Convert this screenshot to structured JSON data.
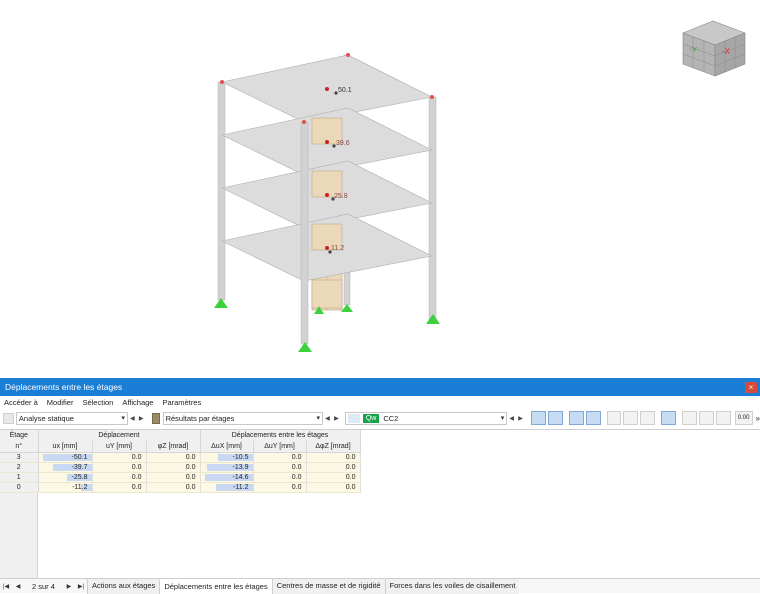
{
  "viewport": {
    "floor_labels": [
      "50.1",
      "39.6",
      "25.8",
      "11.2"
    ],
    "navcube": {
      "y_axis": "-Y",
      "x_axis": "-X"
    }
  },
  "window": {
    "title": "Déplacements entre les étages",
    "close": "×"
  },
  "menu": [
    "Accéder à",
    "Modifier",
    "Sélection",
    "Affichage",
    "Paramètres"
  ],
  "toolbar": {
    "analysis": "Analyse statique",
    "results": "Résultats par étages",
    "load_type": "Qw",
    "load_case": "CC2",
    "zoom_value": "0.00",
    "overflow": "»"
  },
  "table": {
    "col_floor": "Étage",
    "col_floor_sub": "n°",
    "group_disp": "Déplacement",
    "group_drift": "Déplacements entre les étages",
    "cols": [
      "ux [mm]",
      "uY [mm]",
      "φZ [mrad]",
      "ΔuX [mm]",
      "ΔuY [mm]",
      "ΔφZ [mrad]"
    ],
    "rows": [
      {
        "floor": "3",
        "ux": "-50.1",
        "uy": "0.0",
        "phiz": "0.0",
        "dux": "-10.5",
        "duy": "0.0",
        "dphiz": "0.0"
      },
      {
        "floor": "2",
        "ux": "-39.7",
        "uy": "0.0",
        "phiz": "0.0",
        "dux": "-13.9",
        "duy": "0.0",
        "dphiz": "0.0"
      },
      {
        "floor": "1",
        "ux": "-25.8",
        "uy": "0.0",
        "phiz": "0.0",
        "dux": "-14.6",
        "duy": "0.0",
        "dphiz": "0.0"
      },
      {
        "floor": "0",
        "ux": "-11.2",
        "uy": "0.0",
        "phiz": "0.0",
        "dux": "-11.2",
        "duy": "0.0",
        "dphiz": "0.0"
      }
    ]
  },
  "status": {
    "page_info": "2 sur 4",
    "tabs": [
      "Actions aux étages",
      "Déplacements entre les étages",
      "Centres de masse et de rigidité",
      "Forces dans les voiles de cisaillement"
    ]
  },
  "colors": {
    "accent": "#1a7dd6",
    "row_bg": "#fdf8e3",
    "bar": "#c9d9f4",
    "support": "#3dd13d"
  }
}
